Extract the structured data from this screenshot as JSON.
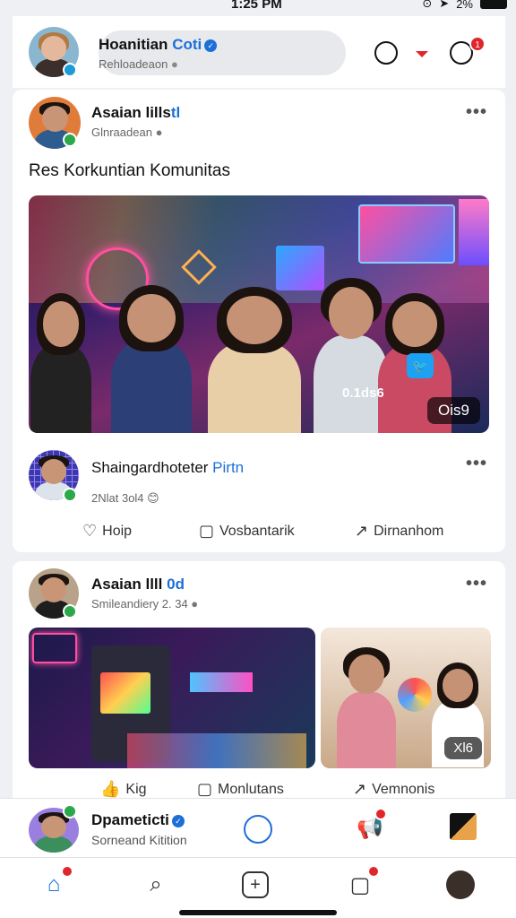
{
  "status": {
    "time": "1:25 PM",
    "battery": "2%"
  },
  "header": {
    "name_part1": "Hoanitian",
    "name_part2": "Coti",
    "subtitle": "Rehloadeaon"
  },
  "posts": [
    {
      "author": "Asaian lills",
      "author_accent": "tl",
      "subtitle": "Glnraadean",
      "caption": "Res Korkuntian Komunitas",
      "photo_label": "Ois9",
      "photo_overlay": "0.1ds6",
      "shared_by_part1": "Shaingardhoteter",
      "shared_by_part2": "Pirtn",
      "shared_time": "2Nlat 3ol4",
      "actions": [
        "Hoip",
        "Vosbantarik",
        "Dirnanhom"
      ]
    },
    {
      "author": "Asaian llll",
      "author_accent": "0d",
      "subtitle": "Smileandiery 2. 34",
      "photo_label": "Xl6",
      "actions": [
        "Kig",
        "Monlutans",
        "Vemnonis"
      ]
    }
  ],
  "bottom_profile": {
    "name": "Dpameticti",
    "subtitle": "Sorneand Kitition"
  },
  "icons": {
    "header": [
      "timer-icon",
      "dropdown-caret-icon",
      "messenger-icon"
    ],
    "tabs": [
      "home-icon",
      "search-icon",
      "add-post-icon",
      "chat-icon",
      "profile-icon"
    ]
  },
  "colors": {
    "accent": "#1d6fd8",
    "badge_red": "#e0262a",
    "online_green": "#2ba84a"
  },
  "notification_count": "1"
}
